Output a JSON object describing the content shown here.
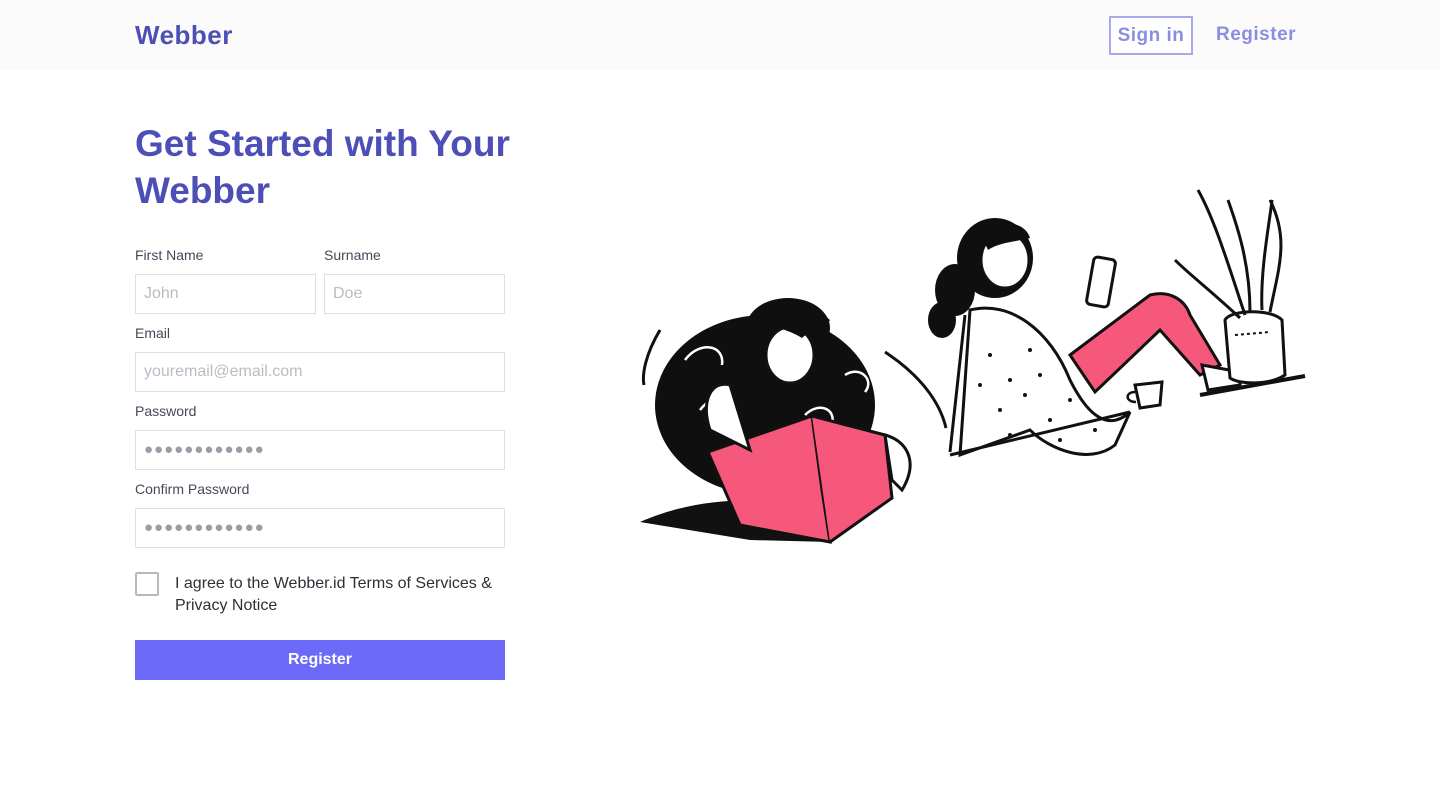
{
  "header": {
    "brand": "Webber",
    "signin_label": "Sign in",
    "register_label": "Register"
  },
  "main": {
    "headline": "Get Started with Your Webber",
    "form": {
      "first_name": {
        "label": "First Name",
        "placeholder": "John"
      },
      "surname": {
        "label": "Surname",
        "placeholder": "Doe"
      },
      "email": {
        "label": "Email",
        "placeholder": "youremail@email.com"
      },
      "password": {
        "label": "Password",
        "placeholder": "●●●●●●●●●●●●"
      },
      "confirm_password": {
        "label": "Confirm Password",
        "placeholder": "●●●●●●●●●●●●"
      },
      "agree_text": "I agree to the Webber.id Terms of Services & Privacy Notice",
      "agree_checked": false,
      "submit_label": "Register"
    }
  },
  "colors": {
    "brand": "#4c4fb5",
    "accent_button": "#6c6af8",
    "nav_link": "#8b8ee0",
    "illustration_pink": "#f5587b"
  },
  "illustration": {
    "icon": "people-reading-illustration"
  }
}
